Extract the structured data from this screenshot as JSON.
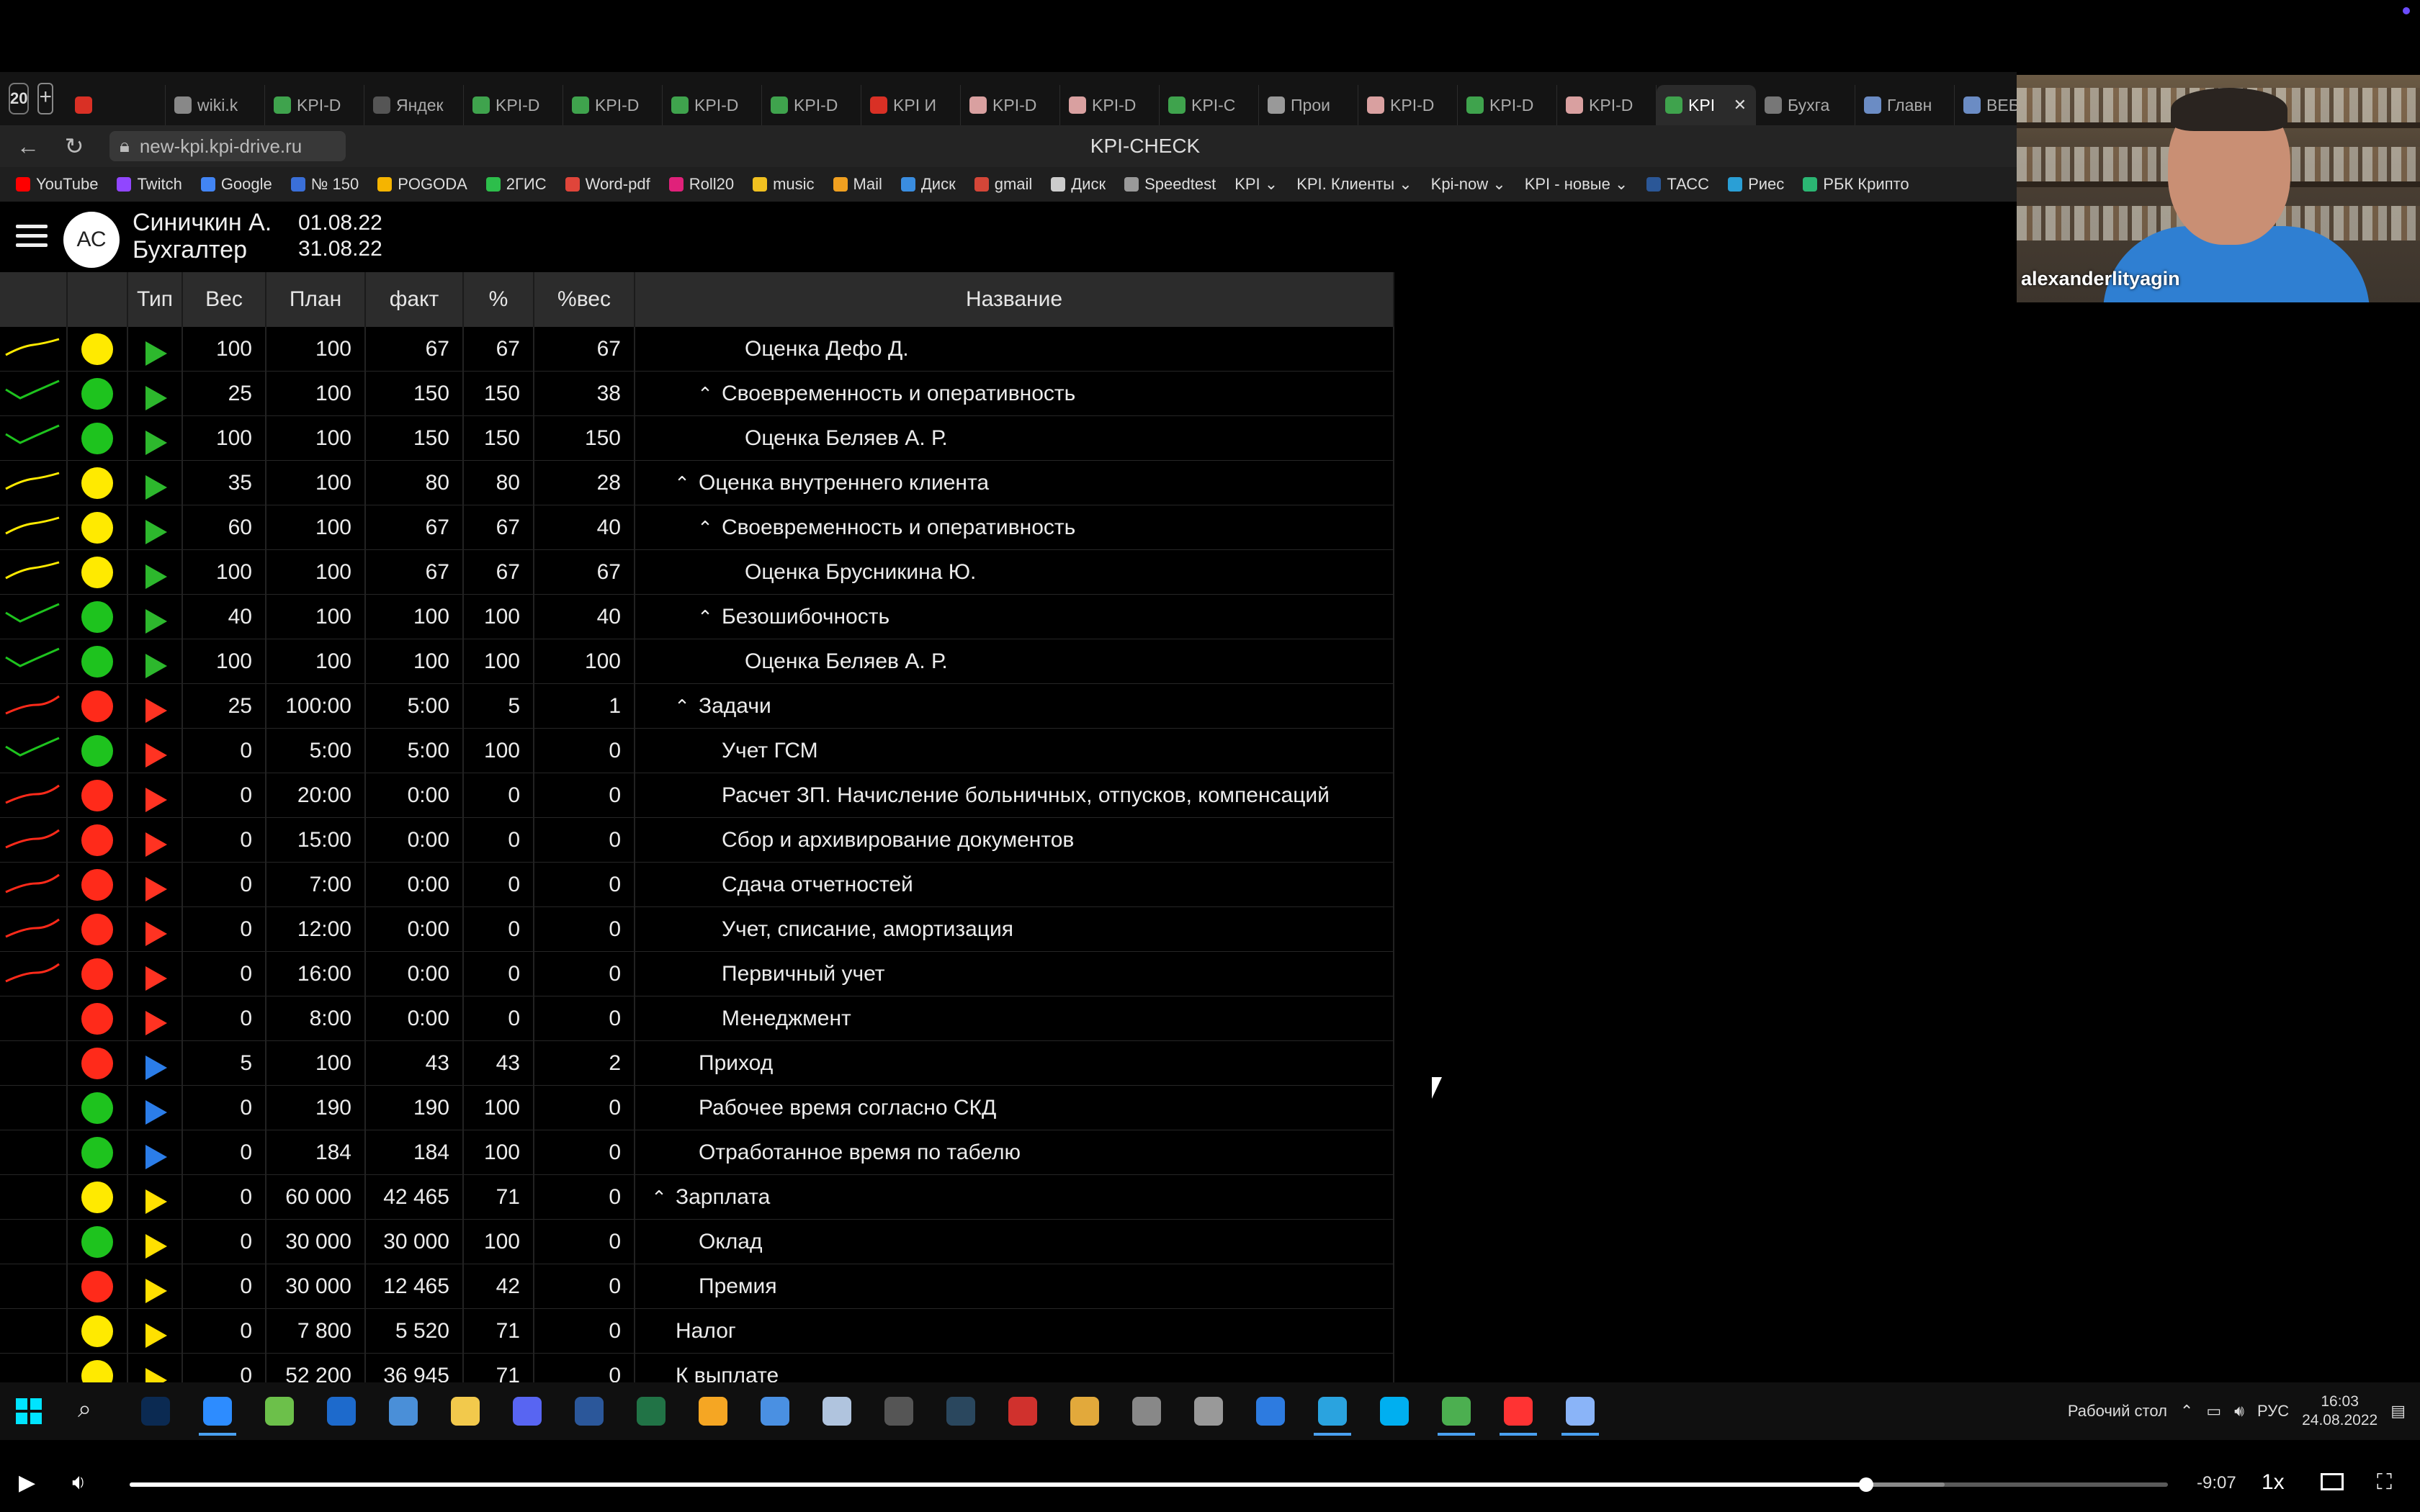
{
  "browser": {
    "tab_count": "20",
    "tabs": [
      {
        "label": "",
        "color": "#d93025"
      },
      {
        "label": "wiki.k",
        "color": "#888888"
      },
      {
        "label": "KPI-D",
        "color": "#3fa34d"
      },
      {
        "label": "Яндек",
        "color": "#555555"
      },
      {
        "label": "KPI-D",
        "color": "#3fa34d"
      },
      {
        "label": "KPI-D",
        "color": "#3fa34d"
      },
      {
        "label": "KPI-D",
        "color": "#3fa34d"
      },
      {
        "label": "KPI-D",
        "color": "#3fa34d"
      },
      {
        "label": "KPI И",
        "color": "#d93025"
      },
      {
        "label": "KPI-D",
        "color": "#d9a0a0"
      },
      {
        "label": "KPI-D",
        "color": "#d9a0a0"
      },
      {
        "label": "KPI-C",
        "color": "#3fa34d"
      },
      {
        "label": "Прои",
        "color": "#999999"
      },
      {
        "label": "KPI-D",
        "color": "#d9a0a0"
      },
      {
        "label": "KPI-D",
        "color": "#3fa34d"
      },
      {
        "label": "KPI-D",
        "color": "#d9a0a0"
      },
      {
        "label": "KPI",
        "color": "#3fa34d",
        "active": true
      },
      {
        "label": "Бухга",
        "color": "#777777"
      },
      {
        "label": "Главн",
        "color": "#6b8cc4"
      },
      {
        "label": "ВЕБИ",
        "color": "#6b8cc4"
      }
    ],
    "url": "new-kpi.kpi-drive.ru",
    "page_title": "KPI-CHECK",
    "bookmarks": [
      {
        "label": "YouTube",
        "color": "#ff0000"
      },
      {
        "label": "Twitch",
        "color": "#9146ff"
      },
      {
        "label": "Google",
        "color": "#4285f4"
      },
      {
        "label": "№ 150",
        "color": "#3a6fd8"
      },
      {
        "label": "POGODA",
        "color": "#f5b400"
      },
      {
        "label": "2ГИС",
        "color": "#2dbe4b"
      },
      {
        "label": "Word-pdf",
        "color": "#e0453a"
      },
      {
        "label": "Roll20",
        "color": "#e0217a"
      },
      {
        "label": "music",
        "color": "#f0c020"
      },
      {
        "label": "Mail",
        "color": "#f0a020"
      },
      {
        "label": "Диск",
        "color": "#3a8de0"
      },
      {
        "label": "gmail",
        "color": "#d44638"
      },
      {
        "label": "Диск",
        "color": "#cccccc"
      },
      {
        "label": "Speedtest",
        "color": "#999999"
      },
      {
        "label": "KPI ⌄",
        "color": ""
      },
      {
        "label": "KPI. Клиенты ⌄",
        "color": ""
      },
      {
        "label": "Kpi-now ⌄",
        "color": ""
      },
      {
        "label": "KPI - новые ⌄",
        "color": ""
      },
      {
        "label": "ТАСС",
        "color": "#2b5797"
      },
      {
        "label": "Риес",
        "color": "#2a9fd6"
      },
      {
        "label": "РБК Крипто",
        "color": "#2bb673"
      }
    ]
  },
  "app": {
    "avatar_initials": "АС",
    "user_name": "Синичкин А.",
    "user_role": "Бухгалтер",
    "date_from": "01.08.22",
    "date_to": "31.08.22"
  },
  "table": {
    "headers": {
      "type": "Тип",
      "weight": "Вес",
      "plan": "План",
      "fact": "факт",
      "pct": "%",
      "pct_weight": "%вес",
      "name": "Название"
    },
    "rows": [
      {
        "trend": "yellow",
        "lamp": "yellow",
        "arrow": "green",
        "weight": "100",
        "plan": "100",
        "fact": "67",
        "pct": "67",
        "pct_weight": "67",
        "indent": 3,
        "caret": "",
        "name": "Оценка Дефо Д."
      },
      {
        "trend": "green",
        "lamp": "green",
        "arrow": "green",
        "weight": "25",
        "plan": "100",
        "fact": "150",
        "pct": "150",
        "pct_weight": "38",
        "indent": 2,
        "caret": "^",
        "name": "Своевременность и оперативность"
      },
      {
        "trend": "green",
        "lamp": "green",
        "arrow": "green",
        "weight": "100",
        "plan": "100",
        "fact": "150",
        "pct": "150",
        "pct_weight": "150",
        "indent": 3,
        "caret": "",
        "name": "Оценка Беляев А. Р."
      },
      {
        "trend": "yellow",
        "lamp": "yellow",
        "arrow": "green",
        "weight": "35",
        "plan": "100",
        "fact": "80",
        "pct": "80",
        "pct_weight": "28",
        "indent": 1,
        "caret": "^",
        "name": "Оценка внутреннего клиента"
      },
      {
        "trend": "yellow",
        "lamp": "yellow",
        "arrow": "green",
        "weight": "60",
        "plan": "100",
        "fact": "67",
        "pct": "67",
        "pct_weight": "40",
        "indent": 2,
        "caret": "^",
        "name": "Своевременность и оперативность"
      },
      {
        "trend": "yellow",
        "lamp": "yellow",
        "arrow": "green",
        "weight": "100",
        "plan": "100",
        "fact": "67",
        "pct": "67",
        "pct_weight": "67",
        "indent": 3,
        "caret": "",
        "name": "Оценка Брусникина Ю."
      },
      {
        "trend": "green",
        "lamp": "green",
        "arrow": "green",
        "weight": "40",
        "plan": "100",
        "fact": "100",
        "pct": "100",
        "pct_weight": "40",
        "indent": 2,
        "caret": "^",
        "name": "Безошибочность"
      },
      {
        "trend": "green",
        "lamp": "green",
        "arrow": "green",
        "weight": "100",
        "plan": "100",
        "fact": "100",
        "pct": "100",
        "pct_weight": "100",
        "indent": 3,
        "caret": "",
        "name": "Оценка Беляев А. Р."
      },
      {
        "trend": "red",
        "lamp": "red",
        "arrow": "red",
        "weight": "25",
        "plan": "100:00",
        "fact": "5:00",
        "pct": "5",
        "pct_weight": "1",
        "indent": 1,
        "caret": "^",
        "name": "Задачи"
      },
      {
        "trend": "green",
        "lamp": "green",
        "arrow": "red",
        "weight": "0",
        "plan": "5:00",
        "fact": "5:00",
        "pct": "100",
        "pct_weight": "0",
        "indent": 2,
        "caret": "",
        "name": "Учет ГСМ"
      },
      {
        "trend": "red",
        "lamp": "red",
        "arrow": "red",
        "weight": "0",
        "plan": "20:00",
        "fact": "0:00",
        "pct": "0",
        "pct_weight": "0",
        "indent": 2,
        "caret": "",
        "name": "Расчет ЗП. Начисление больничных, отпусков, компенсаций"
      },
      {
        "trend": "red",
        "lamp": "red",
        "arrow": "red",
        "weight": "0",
        "plan": "15:00",
        "fact": "0:00",
        "pct": "0",
        "pct_weight": "0",
        "indent": 2,
        "caret": "",
        "name": "Сбор и архивирование документов"
      },
      {
        "trend": "red",
        "lamp": "red",
        "arrow": "red",
        "weight": "0",
        "plan": "7:00",
        "fact": "0:00",
        "pct": "0",
        "pct_weight": "0",
        "indent": 2,
        "caret": "",
        "name": "Сдача отчетностей"
      },
      {
        "trend": "red",
        "lamp": "red",
        "arrow": "red",
        "weight": "0",
        "plan": "12:00",
        "fact": "0:00",
        "pct": "0",
        "pct_weight": "0",
        "indent": 2,
        "caret": "",
        "name": "Учет, списание, амортизация"
      },
      {
        "trend": "red",
        "lamp": "red",
        "arrow": "red",
        "weight": "0",
        "plan": "16:00",
        "fact": "0:00",
        "pct": "0",
        "pct_weight": "0",
        "indent": 2,
        "caret": "",
        "name": "Первичный учет"
      },
      {
        "trend": "",
        "lamp": "red",
        "arrow": "red",
        "weight": "0",
        "plan": "8:00",
        "fact": "0:00",
        "pct": "0",
        "pct_weight": "0",
        "indent": 2,
        "caret": "",
        "name": "Менеджмент"
      },
      {
        "trend": "",
        "lamp": "red",
        "arrow": "blue",
        "weight": "5",
        "plan": "100",
        "fact": "43",
        "pct": "43",
        "pct_weight": "2",
        "indent": 1,
        "caret": "",
        "name": "Приход"
      },
      {
        "trend": "",
        "lamp": "green",
        "arrow": "blue",
        "weight": "0",
        "plan": "190",
        "fact": "190",
        "pct": "100",
        "pct_weight": "0",
        "indent": 1,
        "caret": "",
        "name": "Рабочее время согласно СКД"
      },
      {
        "trend": "",
        "lamp": "green",
        "arrow": "blue",
        "weight": "0",
        "plan": "184",
        "fact": "184",
        "pct": "100",
        "pct_weight": "0",
        "indent": 1,
        "caret": "",
        "name": "Отработанное время по табелю"
      },
      {
        "trend": "",
        "lamp": "yellow",
        "arrow": "yellow",
        "weight": "0",
        "plan": "60 000",
        "fact": "42 465",
        "pct": "71",
        "pct_weight": "0",
        "indent": 0,
        "caret": "^",
        "name": "Зарплата"
      },
      {
        "trend": "",
        "lamp": "green",
        "arrow": "yellow",
        "weight": "0",
        "plan": "30 000",
        "fact": "30 000",
        "pct": "100",
        "pct_weight": "0",
        "indent": 1,
        "caret": "",
        "name": "Оклад"
      },
      {
        "trend": "",
        "lamp": "red",
        "arrow": "yellow",
        "weight": "0",
        "plan": "30 000",
        "fact": "12 465",
        "pct": "42",
        "pct_weight": "0",
        "indent": 1,
        "caret": "",
        "name": "Премия"
      },
      {
        "trend": "",
        "lamp": "yellow",
        "arrow": "yellow",
        "weight": "0",
        "plan": "7 800",
        "fact": "5 520",
        "pct": "71",
        "pct_weight": "0",
        "indent": 0,
        "caret": "",
        "name": "Налог"
      },
      {
        "trend": "",
        "lamp": "yellow",
        "arrow": "yellow",
        "weight": "0",
        "plan": "52 200",
        "fact": "36 945",
        "pct": "71",
        "pct_weight": "0",
        "indent": 0,
        "caret": "",
        "name": "К выплате"
      }
    ]
  },
  "webcam": {
    "participant_name": "alexanderlityagin"
  },
  "taskbar": {
    "desktop_label": "Рабочий стол",
    "language": "РУС",
    "time": "16:03",
    "date": "24.08.2022"
  },
  "player": {
    "remaining": "-9:07",
    "speed": "1x",
    "progress_fraction": 0.852
  },
  "colors": {
    "green": "#1ec31e",
    "yellow": "#ffea00",
    "red": "#ff2a1a",
    "blue": "#2b7de9"
  }
}
